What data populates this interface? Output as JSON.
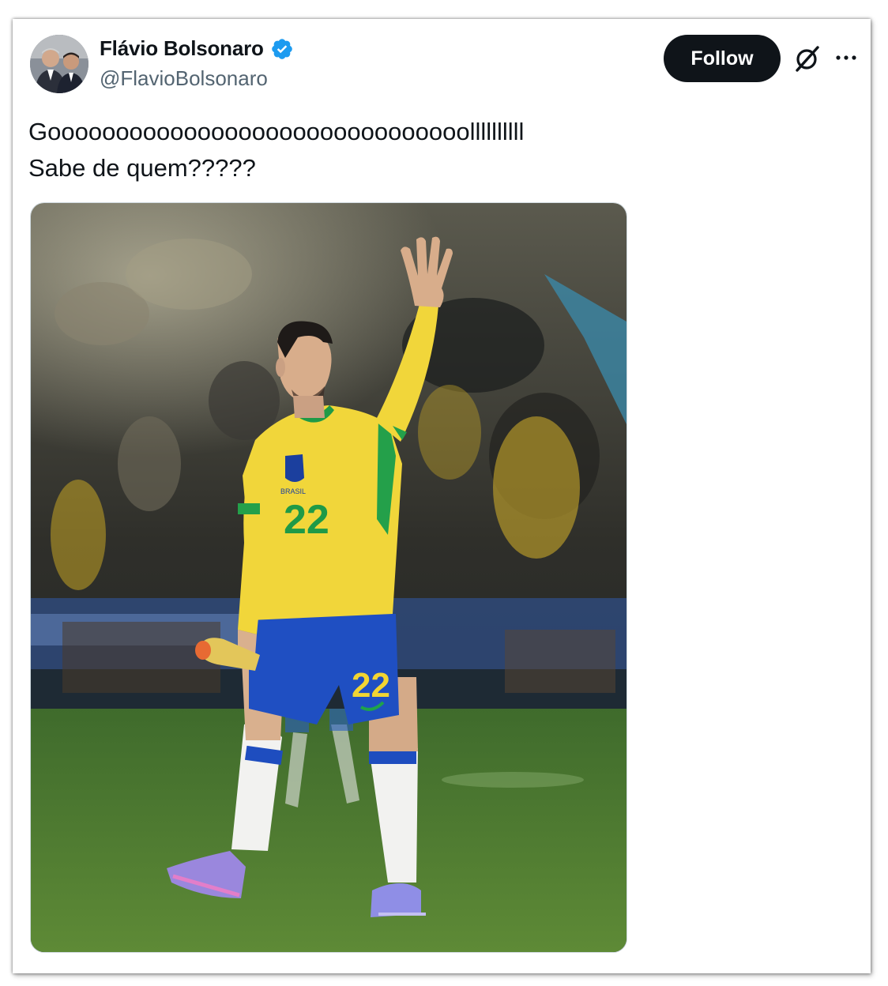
{
  "tweet": {
    "author": {
      "display_name": "Flávio Bolsonaro",
      "handle": "@FlavioBolsonaro",
      "verified": true,
      "avatar_icon": "avatar-photo"
    },
    "follow_label": "Follow",
    "actions": {
      "grok_icon": "grok-icon",
      "more_icon": "more-icon"
    },
    "text_lines": [
      "Gooooooooooooooooooooooooooooooollllllllll",
      "Sabe de quem?????"
    ],
    "media": {
      "type": "photo",
      "jersey_number": "22",
      "crest_text": "BRASIL"
    }
  },
  "colors": {
    "text_primary": "#0f1419",
    "text_secondary": "#536471",
    "follow_bg": "#0f1419",
    "verified_blue": "#1d9bf0",
    "jersey_yellow": "#f3d93a",
    "shorts_blue": "#1f4fc2",
    "pitch_green": "#4f7a2f"
  }
}
